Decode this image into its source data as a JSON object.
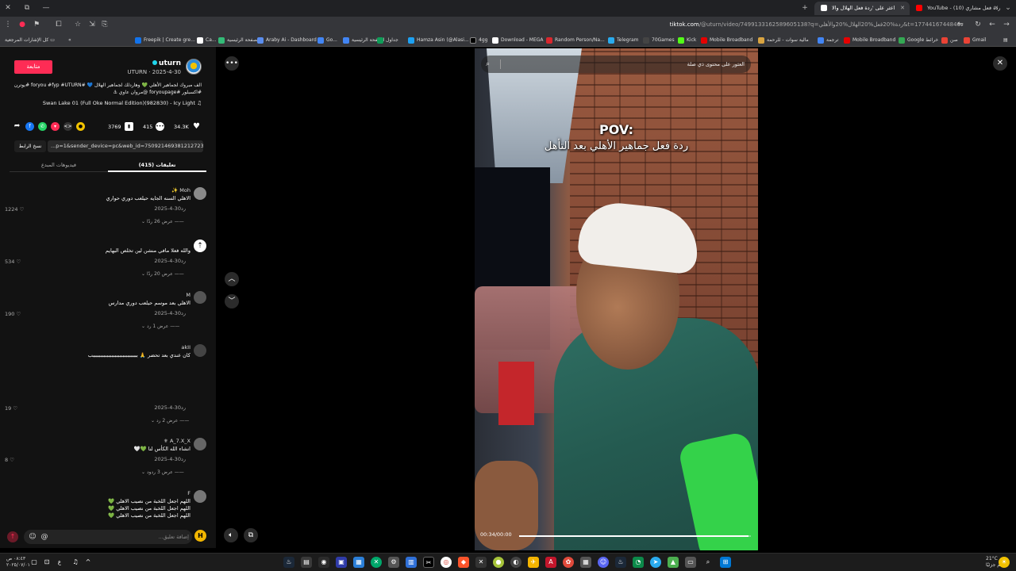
{
  "browser": {
    "tabs": [
      {
        "label": "YouTube - (10) ردة فعل مشاري",
        "active": false,
        "favicon_color": "#ff0000"
      },
      {
        "label": "اعثر على 'ردة فعل الهلال والا",
        "active": true,
        "favicon_color": "#ffffff"
      }
    ],
    "url_domain": "tiktok.com",
    "url_path": "/@uturn/video/7499133162589605138?q=ردة%20فعل%20الهلال%20والأهلي&t=1774416744846",
    "bookmarks": [
      "Gmail",
      "صن",
      "Google خرائط",
      "Mobile Broadband",
      "ترجمة",
      "مالية سوات - للرحمة",
      "Mobile Broadband",
      "Kick",
      "70Games",
      "Telegram",
      "Random Person/Na...",
      "Download - MEGA",
      "4gg",
      "Hamza Asin (@Alasi...",
      "جداول",
      "الصفحة الرئيسية",
      "Go...",
      "Araby Ai - Dashboard",
      "الصفحة الرئيسية",
      "Ca...",
      "Freepik | Create gre..."
    ],
    "all_bookmarks_label": "كل الإشارات المرجعية"
  },
  "post": {
    "username": "uturn",
    "subline": "UTURN · 2025-4-30",
    "follow_label": "متابعة",
    "description_line1": "الف مبروك لجماهير الأهلي 💚 وهاردلك لجماهير الهلال 💙 #foryou #fyp #UTURN #يوترن",
    "description_line2": "#اكسبلور #foryoupage @مروان عاوي ⚓",
    "music": "Swan Lake 01 (Full Oke Normal Edition)(982830) - Icy Light ♫",
    "likes": "34.3K",
    "comments": "415",
    "saves": "3769",
    "copy_link_label": "نسخ الرابط",
    "link": "...p=1&sender_device=pc&web_id=7509214693812127237",
    "tab_comments": "تعليقات (415)",
    "tab_creator_videos": "فيديوهات المبدع"
  },
  "comments": [
    {
      "name": "Moh ✨",
      "text": "الاهلي السنه الجايه حيلعب دوري حواري",
      "date": "2025-4-30",
      "reply": "رد",
      "likes": "1224",
      "more": "عرض 26 ردًا",
      "avatar_color": "#8a8a8a"
    },
    {
      "name": "",
      "text": "والله فعلا مافي منشن لين تخلص البهايم",
      "date": "2025-4-30",
      "reply": "رد",
      "likes": "534",
      "more": "عرض 20 ردًا",
      "avatar_color": "#ffffff"
    },
    {
      "name": "M",
      "text": "الاهلي بعد موسم حيلعب دوري مدارس",
      "date": "2025-4-30",
      "reply": "رد",
      "likes": "190",
      "more": "عرض 1 رد",
      "avatar_color": "#555555"
    },
    {
      "name": "akII",
      "text": "كان عندي بعد تحضر 🙏 بببببببببببببببببببببببببببببب",
      "date": "2025-4-30",
      "reply": "رد",
      "likes": "19",
      "more": "عرض 2 رد",
      "avatar_color": "#444444"
    },
    {
      "name": "A_7.X_X ⚜",
      "text": "انشاء الله الكأس لنا 💚🤍",
      "date": "2025-4-30",
      "reply": "رد",
      "likes": "8",
      "more": "عرض 3 ردود",
      "avatar_color": "#666666"
    },
    {
      "name": "F",
      "text": "اللهم اجعل اللخبة من نصيب الاهلي 💚",
      "date": "",
      "reply": "",
      "likes": "",
      "more": "",
      "avatar_color": "#777777"
    }
  ],
  "comment_input": {
    "placeholder": "إضافة تعليق..."
  },
  "video": {
    "search_placeholder": "العثور على محتوى ذي صلة",
    "overlay_title": "POV:",
    "overlay_caption": "ردة فعل جماهير الأهلي بعد التأهل",
    "time": "00:34/00:00",
    "progress": 0.99
  },
  "taskbar": {
    "weather": "21°C",
    "weather_sub": "غائم جزئيًا",
    "time": "٠٨:٤٣ ص",
    "date": "٢٠٢٥/٠٧/٠١"
  }
}
